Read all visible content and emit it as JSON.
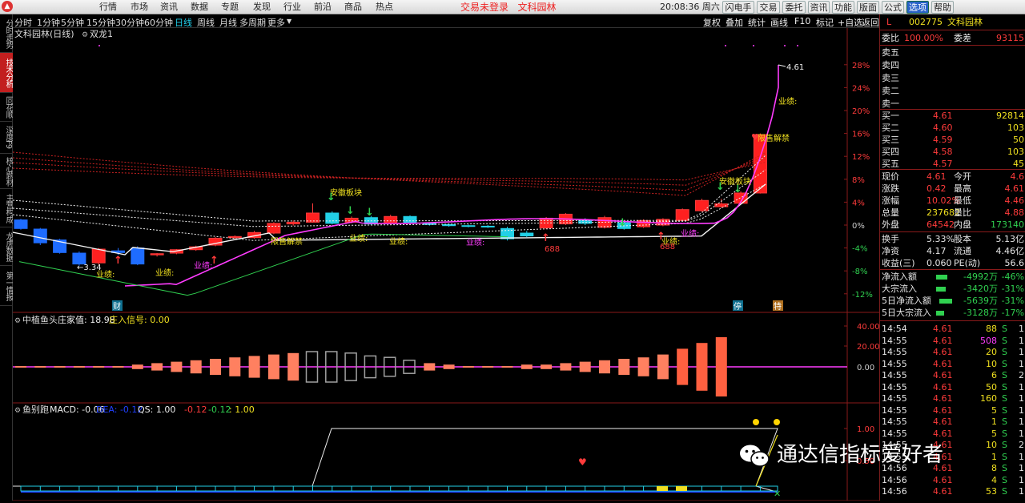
{
  "menubar": {
    "items": [
      "行情",
      "市场",
      "资讯",
      "数据",
      "专题",
      "发现",
      "行业",
      "前沿",
      "商品",
      "热点"
    ],
    "notice_login": "交易未登录",
    "notice_stock": "文科园林",
    "clock": "20:08:36 周六",
    "buttons": [
      "闪电手",
      "交易",
      "委托",
      "资讯",
      "功能",
      "版面",
      "公式",
      "选项",
      "帮助"
    ]
  },
  "left_tabs": [
    "分时走势",
    "技术分析",
    "同花顺",
    "深度F9",
    "核心题材",
    "主营构成",
    "龙虎数据",
    "第一情报"
  ],
  "period_bar": {
    "periods": [
      "分时",
      "1分钟",
      "5分钟",
      "15分钟",
      "30分钟",
      "60分钟",
      "日线",
      "周线",
      "月线",
      "多周期",
      "更多"
    ],
    "active": "日线",
    "tools": [
      "复权",
      "叠加",
      "统计",
      "画线",
      "F10",
      "标记",
      "+自选",
      "返回"
    ]
  },
  "main_chart": {
    "title": "文科园林(日线)",
    "indicator": "双龙1",
    "last_price_label": "4.61",
    "low_price_label": "←3.34",
    "pct_axis": [
      "28%",
      "24%",
      "20%",
      "16%",
      "12%",
      "8%",
      "4%",
      "0%",
      "-4%",
      "-8%",
      "-12%"
    ],
    "annotations": {
      "anhui_1": "安徽板块",
      "anhui_2": "安徽板块",
      "xianshou": "限售解禁",
      "xianshou2": "限售解禁",
      "yeji": "业绩:",
      "code688": "688"
    },
    "bottom_markers": [
      "财",
      "停",
      "特"
    ],
    "candles": [
      {
        "o": 0.9,
        "c": -0.6,
        "h": 1.1,
        "l": -0.8
      },
      {
        "o": -0.7,
        "c": -3.1,
        "h": -0.5,
        "l": -3.5
      },
      {
        "o": -2.6,
        "c": -4.8,
        "h": -2.4,
        "l": -5.0
      },
      {
        "o": -4.9,
        "c": -6.8,
        "h": -4.6,
        "l": -7.1
      },
      {
        "o": -6.6,
        "c": -4.2,
        "h": -4.0,
        "l": -6.9
      },
      {
        "o": -4.5,
        "c": -4.8,
        "h": -4.0,
        "l": -5.2
      },
      {
        "o": -4.0,
        "c": -6.8,
        "h": -3.7,
        "l": -7.0
      },
      {
        "o": -5.2,
        "c": -5.0,
        "h": -4.9,
        "l": -5.5
      },
      {
        "o": -4.9,
        "c": -4.3,
        "h": -4.2,
        "l": -5.1
      },
      {
        "o": -4.3,
        "c": -3.8,
        "h": -3.6,
        "l": -4.5
      },
      {
        "o": -3.5,
        "c": -2.3,
        "h": -2.1,
        "l": -3.7
      },
      {
        "o": -2.2,
        "c": -2.0,
        "h": -1.8,
        "l": -2.4
      },
      {
        "o": -2.2,
        "c": -1.3,
        "h": -1.0,
        "l": -2.4
      },
      {
        "o": -1.4,
        "c": 0.3,
        "h": 0.5,
        "l": -1.6
      },
      {
        "o": 0.2,
        "c": 0.5,
        "h": 0.8,
        "l": -0.1
      },
      {
        "o": 0.5,
        "c": 2.1,
        "h": 3.8,
        "l": 0.4
      },
      {
        "o": 2.1,
        "c": 0.3,
        "h": 2.4,
        "l": 0.1
      },
      {
        "o": 0.5,
        "c": 1.2,
        "h": 1.5,
        "l": 0.3
      },
      {
        "o": 1.3,
        "c": 0.2,
        "h": 1.6,
        "l": 0.0
      },
      {
        "o": 0.3,
        "c": 1.5,
        "h": 1.8,
        "l": 0.1
      },
      {
        "o": 1.5,
        "c": 0.3,
        "h": 1.7,
        "l": 0.1
      },
      {
        "o": 0.3,
        "c": 0.1,
        "h": 0.5,
        "l": -0.1
      },
      {
        "o": 0.1,
        "c": -0.1,
        "h": 0.3,
        "l": -0.3
      },
      {
        "o": -0.1,
        "c": -0.2,
        "h": 0.1,
        "l": -0.4
      },
      {
        "o": -0.2,
        "c": -0.3,
        "h": 0.0,
        "l": -0.5
      },
      {
        "o": -0.6,
        "c": -2.4,
        "h": -0.3,
        "l": -2.7
      },
      {
        "o": -1.4,
        "c": -1.9,
        "h": -1.0,
        "l": -2.1
      },
      {
        "o": -0.5,
        "c": 1.2,
        "h": 1.4,
        "l": -0.7
      },
      {
        "o": 0.2,
        "c": 1.9,
        "h": 2.1,
        "l": 0.0
      },
      {
        "o": 0.8,
        "c": 0.3,
        "h": 1.2,
        "l": 0.0
      },
      {
        "o": -0.4,
        "c": 1.3,
        "h": 1.6,
        "l": -0.6
      },
      {
        "o": 0.4,
        "c": -0.6,
        "h": 0.7,
        "l": -0.8
      },
      {
        "o": -0.3,
        "c": 0.8,
        "h": 1.0,
        "l": -0.5
      },
      {
        "o": 0.0,
        "c": 1.0,
        "h": 1.2,
        "l": -0.2
      },
      {
        "o": 0.8,
        "c": 2.7,
        "h": 2.9,
        "l": 0.6
      },
      {
        "o": 2.5,
        "c": 4.3,
        "h": 4.6,
        "l": 2.3
      },
      {
        "o": 3.2,
        "c": 3.7,
        "h": 4.6,
        "l": 3.0
      },
      {
        "o": 3.8,
        "c": 5.6,
        "h": 5.9,
        "l": 3.6
      },
      {
        "o": 5.6,
        "c": 15.8,
        "h": 16.0,
        "l": 5.5
      }
    ],
    "ma_lines": {
      "note": ""
    }
  },
  "indicator_1": {
    "title": "中植鱼头",
    "label": "庄家值: 18.98",
    "label2": "庄入信号: 0.00",
    "axis": [
      "40.00",
      "20.00",
      "0.00"
    ],
    "bars": [
      0,
      0,
      0,
      0,
      0,
      0,
      0.1,
      0.2,
      0.3,
      0.4,
      0.5,
      0.6,
      0.7,
      0.8,
      0.9,
      -1.0,
      -1.0,
      -0.9,
      -0.7,
      -0.6,
      -0.4,
      0.2,
      0.1,
      0.0,
      0.0,
      0.0,
      0.1,
      0.1,
      0.2,
      0.3,
      0.4,
      0.5,
      0.6,
      0.8,
      1.2,
      1.6,
      2.0
    ]
  },
  "indicator_2": {
    "title": "鱼别跑",
    "macd": "MACD: -0.06",
    "dea": "DEA: -0.12",
    "qs": "QS: 1.00",
    "v1": "-0.12",
    "v2": "-0.12",
    "v3": ": 1.00",
    "axis": [
      "1.00",
      "0.50"
    ]
  },
  "quote": {
    "code": "002775",
    "name": "文科园林",
    "badge": "L",
    "weibi_label": "委比",
    "weibi": "100.00%",
    "weicha_label": "委差",
    "weicha": "93115",
    "asks": [
      {
        "label": "卖五",
        "price": "",
        "vol": ""
      },
      {
        "label": "卖四",
        "price": "",
        "vol": ""
      },
      {
        "label": "卖三",
        "price": "",
        "vol": ""
      },
      {
        "label": "卖二",
        "price": "",
        "vol": ""
      },
      {
        "label": "卖一",
        "price": "",
        "vol": ""
      }
    ],
    "bids": [
      {
        "label": "买一",
        "price": "4.61",
        "vol": "92814"
      },
      {
        "label": "买二",
        "price": "4.60",
        "vol": "103"
      },
      {
        "label": "买三",
        "price": "4.59",
        "vol": "50"
      },
      {
        "label": "买四",
        "price": "4.58",
        "vol": "103"
      },
      {
        "label": "买五",
        "price": "4.57",
        "vol": "45"
      }
    ],
    "stats": [
      {
        "l1": "现价",
        "v1": "4.61",
        "l2": "今开",
        "v2": "4.6"
      },
      {
        "l1": "涨跌",
        "v1": "0.42",
        "l2": "最高",
        "v2": "4.61"
      },
      {
        "l1": "涨幅",
        "v1": "10.02%",
        "l2": "最低",
        "v2": "4.46"
      },
      {
        "l1": "总量",
        "v1": "237682",
        "l2": "量比",
        "v2": "4.88"
      },
      {
        "l1": "外盘",
        "v1": "64542",
        "l2": "内盘",
        "v2": "173140"
      }
    ],
    "stats2": [
      {
        "l1": "换手",
        "v1": "5.33%",
        "l2": "股本",
        "v2": "5.13亿"
      },
      {
        "l1": "净资",
        "v1": "4.17",
        "l2": "流通",
        "v2": "4.46亿"
      },
      {
        "l1": "收益(三)",
        "v1": "0.060",
        "l2": "PE(动)",
        "v2": "56.6"
      }
    ],
    "flows": [
      {
        "label": "净流入额",
        "value": "-4992万",
        "pct": "-46%"
      },
      {
        "label": "大宗流入",
        "value": "-3420万",
        "pct": "-31%"
      },
      {
        "label": "5日净流入额",
        "value": "-5639万",
        "pct": "-31%"
      },
      {
        "label": "5日大宗流入",
        "value": "-3128万",
        "pct": "-17%"
      }
    ],
    "ticks": [
      {
        "t": "14:54",
        "p": "4.61",
        "v": "88",
        "s": "S",
        "n": "1"
      },
      {
        "t": "14:55",
        "p": "4.61",
        "v": "508",
        "s": "S",
        "n": "1"
      },
      {
        "t": "14:55",
        "p": "4.61",
        "v": "20",
        "s": "S",
        "n": "1"
      },
      {
        "t": "14:55",
        "p": "4.61",
        "v": "10",
        "s": "S",
        "n": "1"
      },
      {
        "t": "14:55",
        "p": "4.61",
        "v": "6",
        "s": "S",
        "n": "2"
      },
      {
        "t": "14:55",
        "p": "4.61",
        "v": "50",
        "s": "S",
        "n": "1"
      },
      {
        "t": "14:55",
        "p": "4.61",
        "v": "160",
        "s": "S",
        "n": "1"
      },
      {
        "t": "14:55",
        "p": "4.61",
        "v": "5",
        "s": "S",
        "n": "1"
      },
      {
        "t": "14:55",
        "p": "4.61",
        "v": "1",
        "s": "S",
        "n": "1"
      },
      {
        "t": "14:55",
        "p": "4.61",
        "v": "5",
        "s": "S",
        "n": "1"
      },
      {
        "t": "14:55",
        "p": "4.61",
        "v": "10",
        "s": "S",
        "n": "2"
      },
      {
        "t": "14:55",
        "p": "4.61",
        "v": "1",
        "s": "S",
        "n": "1"
      },
      {
        "t": "14:56",
        "p": "4.61",
        "v": "8",
        "s": "S",
        "n": "1"
      },
      {
        "t": "14:56",
        "p": "4.61",
        "v": "4",
        "s": "S",
        "n": "1"
      },
      {
        "t": "14:56",
        "p": "4.61",
        "v": "53",
        "s": "S",
        "n": "1"
      }
    ]
  },
  "watermark": "通达信指标爱好者",
  "colors": {
    "up": "#ff3b3b",
    "down": "#2fd0e6",
    "accent": "#f0e020",
    "magenta": "#ff3cff"
  }
}
